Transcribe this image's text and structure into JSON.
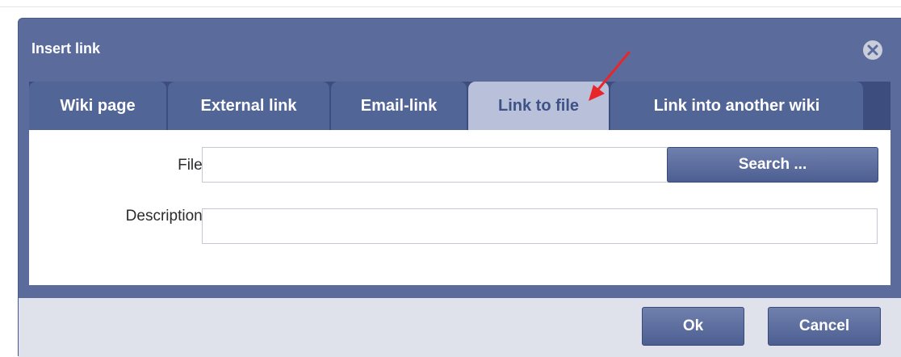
{
  "dialog": {
    "title": "Insert link",
    "close_icon": "close-circle-icon"
  },
  "tabs": [
    {
      "label": "Wiki page",
      "active": false
    },
    {
      "label": "External link",
      "active": false
    },
    {
      "label": "Email-link",
      "active": false
    },
    {
      "label": "Link to file",
      "active": true
    },
    {
      "label": "Link into another wiki",
      "active": false
    }
  ],
  "form": {
    "file_label": "File:",
    "file_value": "",
    "search_label": "Search ...",
    "description_label": "Description:",
    "description_value": ""
  },
  "footer": {
    "ok_label": "Ok",
    "cancel_label": "Cancel"
  },
  "annotation": {
    "arrow_color": "#e8262a"
  },
  "colors": {
    "dialog": "#5b6c9c",
    "active_tab": "#b8c1d9",
    "inactive_tab": "#526597",
    "footer": "#dfe2eb"
  }
}
